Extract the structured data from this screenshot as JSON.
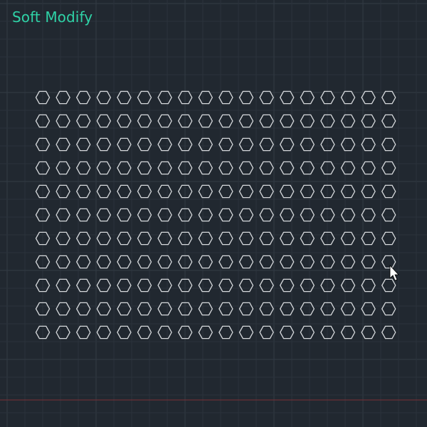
{
  "header": {
    "mode_title": "Soft Modify"
  },
  "icons": {
    "cursor": "arrow-cursor-icon",
    "shape": "hexagon-icon"
  },
  "pattern": {
    "rows": 11,
    "cols": 18,
    "shape": "hexagon"
  },
  "colors": {
    "background": "#212830",
    "grid_minor": "#2a323b",
    "grid_major": "#323b45",
    "axis_x": "#7a2f36",
    "hex_stroke": "#d6d9dc",
    "title": "#2fd3a7",
    "cursor_fill": "#ffffff",
    "cursor_stroke": "#000000"
  }
}
